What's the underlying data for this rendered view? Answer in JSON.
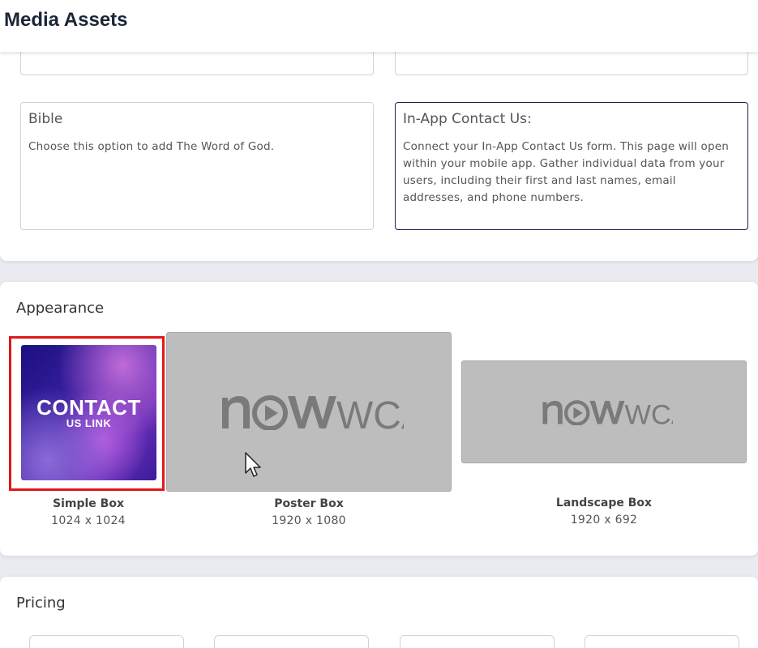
{
  "header": {
    "title": "Media Assets"
  },
  "options": {
    "bible": {
      "title": "Bible",
      "description": "Choose this option to add The Word of God."
    },
    "contact": {
      "title": "In-App Contact Us:",
      "description": "Connect your In-App Contact Us form. This page will open within your mobile app. Gather individual data from your users, including their first and last names, email addresses, and phone numbers."
    }
  },
  "appearance": {
    "title": "Appearance",
    "simple": {
      "name": "Simple Box",
      "size": "1024 x 1024",
      "line1": "CONTACT",
      "line2": "US LINK"
    },
    "poster": {
      "name": "Poster Box",
      "size": "1920 x 1080"
    },
    "landscape": {
      "name": "Landscape Box",
      "size": "1920 x 692"
    },
    "logo_text_left": "n",
    "logo_text_right": "WCAST"
  },
  "pricing": {
    "title": "Pricing"
  },
  "colors": {
    "selected_border": "#e01818",
    "accent_border": "#1d2150"
  }
}
